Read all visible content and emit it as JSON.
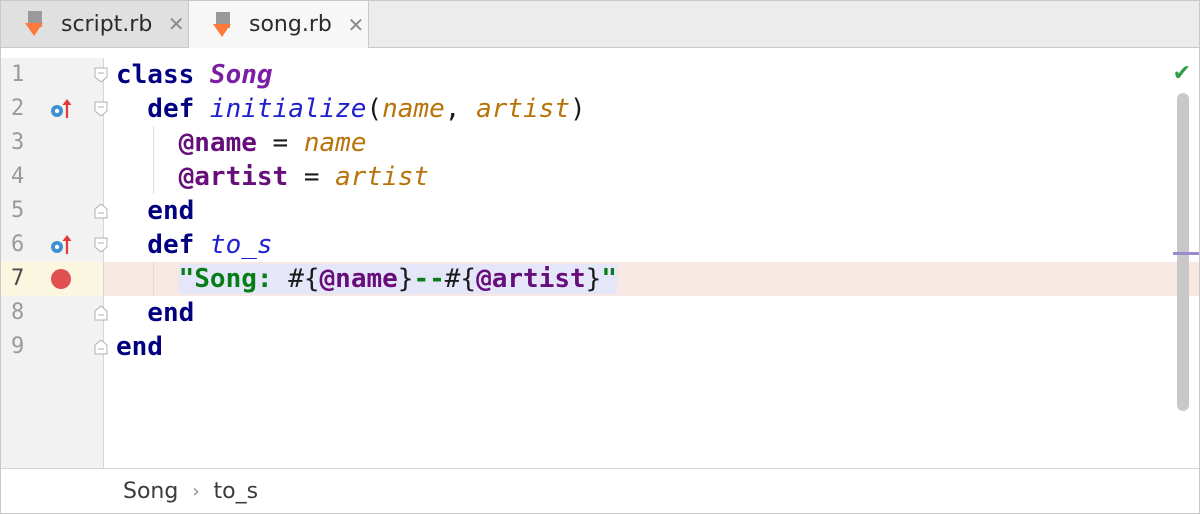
{
  "tabs": [
    {
      "label": "script.rb",
      "active": false,
      "close": "✕"
    },
    {
      "label": "song.rb",
      "active": true,
      "close": "✕"
    }
  ],
  "editor": {
    "line_numbers": [
      "1",
      "2",
      "3",
      "4",
      "5",
      "6",
      "7",
      "8",
      "9"
    ],
    "current_line": 7,
    "lines": [
      [
        {
          "t": "class ",
          "c": "kw"
        },
        {
          "t": "Song",
          "c": "cls"
        }
      ],
      [
        {
          "t": "  def ",
          "c": "kw"
        },
        {
          "t": "initialize",
          "c": "meth"
        },
        {
          "t": "(",
          "c": "punc"
        },
        {
          "t": "name",
          "c": "param"
        },
        {
          "t": ", ",
          "c": "punc"
        },
        {
          "t": "artist",
          "c": "param"
        },
        {
          "t": ")",
          "c": "punc"
        }
      ],
      [
        {
          "t": "    @name",
          "c": "ivar"
        },
        {
          "t": " = ",
          "c": "punc"
        },
        {
          "t": "name",
          "c": "param"
        }
      ],
      [
        {
          "t": "    @artist",
          "c": "ivar"
        },
        {
          "t": " = ",
          "c": "punc"
        },
        {
          "t": "artist",
          "c": "param"
        }
      ],
      [
        {
          "t": "  end",
          "c": "kw"
        }
      ],
      [
        {
          "t": "  def ",
          "c": "kw"
        },
        {
          "t": "to_s",
          "c": "meth"
        }
      ],
      [
        {
          "t": "    ",
          "c": "punc"
        },
        {
          "t": "\"Song: ",
          "c": "str sel"
        },
        {
          "t": "#{",
          "c": "punc sel"
        },
        {
          "t": "@name",
          "c": "ivar sel"
        },
        {
          "t": "}",
          "c": "punc sel"
        },
        {
          "t": "--",
          "c": "str sel"
        },
        {
          "t": "#{",
          "c": "punc sel"
        },
        {
          "t": "@artist",
          "c": "ivar sel"
        },
        {
          "t": "}",
          "c": "punc sel"
        },
        {
          "t": "\"",
          "c": "str sel"
        }
      ],
      [
        {
          "t": "  end",
          "c": "kw"
        }
      ],
      [
        {
          "t": "end",
          "c": "kw"
        }
      ]
    ]
  },
  "gutter_markers": {
    "2": "override-marker-icon",
    "6": "override-marker-icon",
    "7": "breakpoint"
  },
  "status": {
    "inspection": "check-icon"
  },
  "breadcrumb": {
    "items": [
      "Song",
      "to_s"
    ],
    "separator": "›"
  },
  "colors": {
    "keyword": "#000080",
    "class_name": "#7b1fa2",
    "method": "#2020d0",
    "parameter": "#b8730a",
    "instance_var": "#660e7a",
    "string": "#067d17",
    "breakpoint": "#e05050",
    "current_line": "#f8e8e4"
  }
}
